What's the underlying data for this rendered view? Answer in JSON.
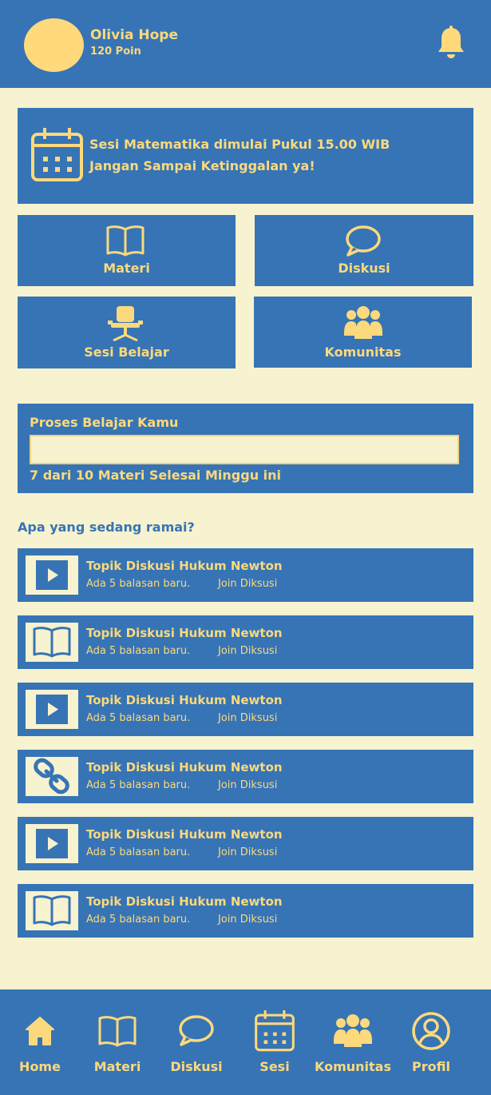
{
  "colors": {
    "primary": "#3674b5",
    "accent": "#fcd97c",
    "background": "#f7f2cf"
  },
  "header": {
    "user_name": "Olivia Hope",
    "points": "120 Poin",
    "avatar_icon": "avatar-circle",
    "notification_icon": "bell-icon"
  },
  "banner": {
    "icon": "calendar-icon",
    "line1": "Sesi Matematika dimulai Pukul 15.00 WIB",
    "line2": "Jangan Sampai Ketinggalan ya!"
  },
  "menu": [
    {
      "label": "Materi",
      "icon": "book-icon"
    },
    {
      "label": "Diskusi",
      "icon": "chat-bubble-icon"
    },
    {
      "label": "Sesi Belajar",
      "icon": "desk-chair-icon"
    },
    {
      "label": "Komunitas",
      "icon": "community-icon"
    }
  ],
  "progress": {
    "title": "Proses Belajar Kamu",
    "caption": "7 dari 10 Materi Selesai Minggu ini",
    "completed": 7,
    "total": 10
  },
  "trending": {
    "title": "Apa yang sedang ramai?",
    "items": [
      {
        "icon": "play-icon",
        "title": "Topik Diskusi Hukum Newton",
        "subtitle": "Ada 5 balasan baru.",
        "action": "Join Diksusi"
      },
      {
        "icon": "book-icon",
        "title": "Topik Diskusi Hukum Newton",
        "subtitle": "Ada 5 balasan baru.",
        "action": "Join Diksusi"
      },
      {
        "icon": "play-icon",
        "title": "Topik Diskusi Hukum Newton",
        "subtitle": "Ada 5 balasan baru.",
        "action": "Join Diksusi"
      },
      {
        "icon": "link-icon",
        "title": "Topik Diskusi Hukum Newton",
        "subtitle": "Ada 5 balasan baru.",
        "action": "Join Diksusi"
      },
      {
        "icon": "play-icon",
        "title": "Topik Diskusi Hukum Newton",
        "subtitle": "Ada 5 balasan baru.",
        "action": "Join Diksusi"
      },
      {
        "icon": "book-icon",
        "title": "Topik Diskusi Hukum Newton",
        "subtitle": "Ada 5 balasan baru.",
        "action": "Join Diksusi"
      }
    ]
  },
  "bottom_nav": [
    {
      "label": "Home",
      "icon": "home-icon"
    },
    {
      "label": "Materi",
      "icon": "book-icon"
    },
    {
      "label": "Diskusi",
      "icon": "chat-bubble-icon"
    },
    {
      "label": "Sesi",
      "icon": "calendar-icon"
    },
    {
      "label": "Komunitas",
      "icon": "community-icon"
    },
    {
      "label": "Profil",
      "icon": "profile-icon"
    }
  ]
}
